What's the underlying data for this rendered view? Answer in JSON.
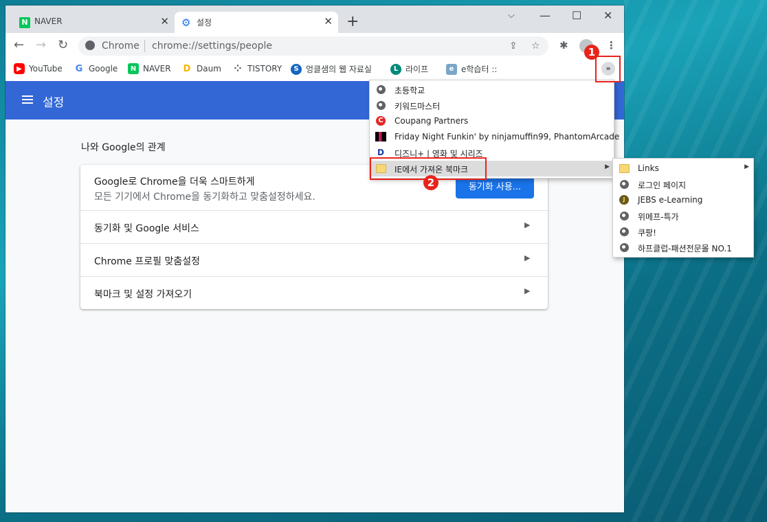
{
  "tabs": [
    {
      "label": "NAVER",
      "favicon": "naver-icon",
      "color": "#03c75a"
    },
    {
      "label": "설정",
      "favicon": "gear-icon",
      "color": "#1a73e8"
    }
  ],
  "window_controls": {
    "dropdown": "⌵",
    "minimize": "—",
    "maximize": "☐",
    "close": "✕"
  },
  "omnibox": {
    "site": "Chrome",
    "url": "chrome://settings/people"
  },
  "bookmarks": [
    {
      "label": "YouTube",
      "icon": "youtube-icon",
      "color": "#ff0000",
      "glyph": "▶"
    },
    {
      "label": "Google",
      "icon": "google-icon",
      "color": "#4285f4",
      "glyph": "G"
    },
    {
      "label": "NAVER",
      "icon": "naver-icon",
      "color": "#03c75a",
      "glyph": "N"
    },
    {
      "label": "Daum",
      "icon": "daum-icon",
      "color": "#f7b500",
      "glyph": "D"
    },
    {
      "label": "TISTORY",
      "icon": "tistory-icon",
      "color": "#333333",
      "glyph": "⁘"
    },
    {
      "label": "엉클샘의 웹 자료실",
      "icon": "uncle-sam-icon",
      "color": "#1565c0",
      "glyph": "S"
    },
    {
      "label": "라이프",
      "icon": "life-icon",
      "color": "#00897b",
      "glyph": "L"
    },
    {
      "label": "e학습터 ::",
      "icon": "elearning-icon",
      "color": "#7aa6c8",
      "glyph": "e"
    }
  ],
  "overflow_button": "»",
  "settings_header": {
    "title": "설정"
  },
  "section_title": "나와 Google의 관계",
  "promo": {
    "title": "Google로 Chrome을 더욱 스마트하게",
    "subtitle": "모든 기기에서 Chrome을 동기화하고 맞춤설정하세요.",
    "sync_button": "동기화 사용..."
  },
  "rows": [
    {
      "label": "동기화 및 Google 서비스"
    },
    {
      "label": "Chrome 프로필 맞춤설정"
    },
    {
      "label": "북마크 및 설정 가져오기"
    }
  ],
  "overflow_menu": [
    {
      "label": "초등학교",
      "icon": "globe-icon"
    },
    {
      "label": "키워드마스터",
      "icon": "globe-icon"
    },
    {
      "label": "Coupang Partners",
      "icon": "coupang-icon"
    },
    {
      "label": "Friday Night Funkin' by ninjamuffin99, PhantomArcade",
      "icon": "game-icon"
    },
    {
      "label": "디즈니+ | 영화 및 시리즈",
      "icon": "disney-icon"
    },
    {
      "label": "IE에서 가져온 북마크",
      "icon": "folder-icon",
      "submenu": true
    }
  ],
  "submenu": [
    {
      "label": "Links",
      "icon": "folder-icon",
      "submenu": true
    },
    {
      "label": "로그인 페이지",
      "icon": "globe-icon"
    },
    {
      "label": "JEBS e-Learning",
      "icon": "jebs-icon"
    },
    {
      "label": "위메프-특가",
      "icon": "globe-icon"
    },
    {
      "label": "쿠팡!",
      "icon": "globe-icon"
    },
    {
      "label": "하프클럽-패션전문몰 NO.1",
      "icon": "globe-icon"
    }
  ],
  "annotations": {
    "step1": "1",
    "step2": "2",
    "highlight_color": "#e8231b"
  }
}
